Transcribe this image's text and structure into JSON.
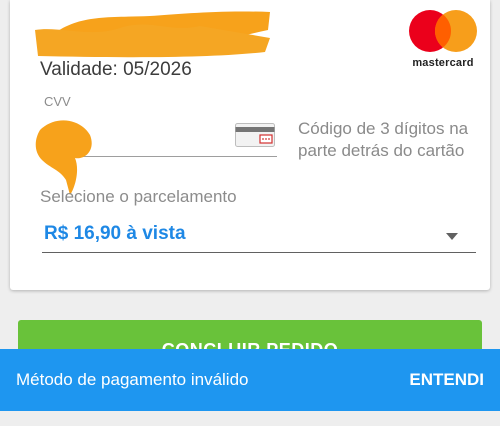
{
  "card": {
    "masked_number": "****",
    "validity": "Validade: 05/2026",
    "brand_label": "mastercard",
    "cvv_label": "CVV",
    "cvv_value": "",
    "cvv_hint": "Código de 3 dígitos na parte detrás do cartão"
  },
  "installments": {
    "label": "Selecione o parcelamento",
    "selected": "R$ 16,90 à vista"
  },
  "conclude_button": {
    "label": "CONCLUIR PEDIDO"
  },
  "snackbar": {
    "message": "Método de pagamento inválido",
    "action": "ENTENDI"
  },
  "colors": {
    "accent_blue": "#1e88e5",
    "snackbar_blue": "#1e96f0",
    "button_green": "#69c23a",
    "redaction_orange": "#f7a21b",
    "mastercard_red": "#eb001b",
    "mastercard_yellow": "#f79e1b"
  }
}
